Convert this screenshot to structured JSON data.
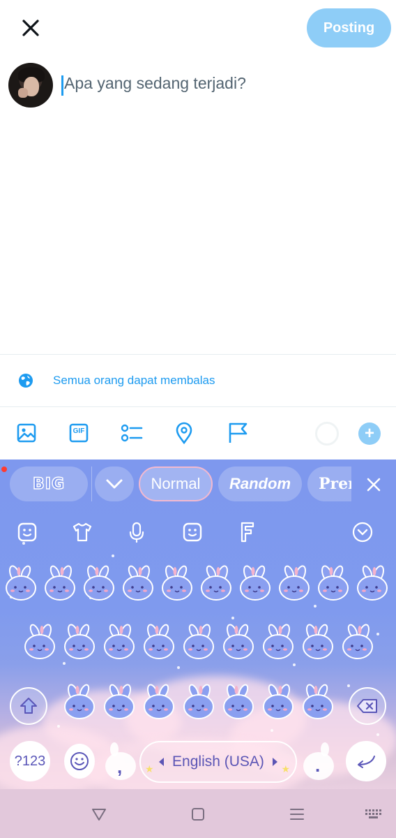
{
  "header": {
    "close_icon": "x-icon",
    "post_label": "Posting"
  },
  "compose": {
    "placeholder": "Apa yang sedang terjadi?"
  },
  "reply_setting": {
    "icon": "globe-icon",
    "label": "Semua orang dapat membalas"
  },
  "toolbar": {
    "items": [
      "image-icon",
      "gif-icon",
      "poll-icon",
      "location-icon",
      "flag-icon"
    ],
    "gif_label": "GIF"
  },
  "keyboard": {
    "font_strip": {
      "chips": [
        "BIG",
        "Normal",
        "Random",
        "Prem"
      ],
      "selected": "Normal"
    },
    "tools": [
      "sticker-icon",
      "shirt-icon",
      "microphone-icon",
      "emoji-icon",
      "font-icon",
      "chevron-down-icon"
    ],
    "numeric_label": "?123",
    "comma_label": ",",
    "period_label": ".",
    "space_label": "English (USA)",
    "colors": {
      "background": "#7e98ee",
      "key_outline": "#ffffff",
      "label": "#5a56b8"
    }
  },
  "navbar": {
    "buttons": [
      "back-icon",
      "home-icon",
      "recents-icon",
      "keyboard-icon"
    ]
  },
  "colors": {
    "accent": "#1d9bf0",
    "post_button_disabled": "#8ecdf7"
  }
}
